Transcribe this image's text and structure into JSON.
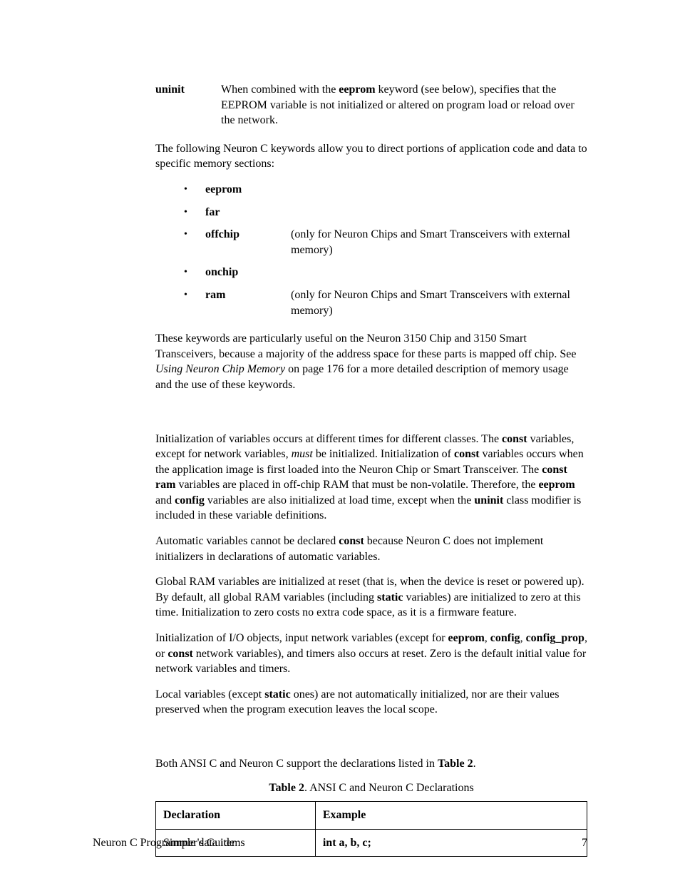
{
  "uninit": {
    "label": "uninit",
    "desc_pre": "When combined with the ",
    "desc_kw": "eeprom",
    "desc_post": " keyword (see below), specifies that the EEPROM variable is not initialized or altered on program load or reload over the network."
  },
  "para1": "The following Neuron C keywords allow you to direct portions of application code and data to specific memory sections:",
  "keywords": [
    {
      "kw": "eeprom",
      "note": ""
    },
    {
      "kw": "far",
      "note": ""
    },
    {
      "kw": "offchip",
      "note": "(only for Neuron Chips and Smart Transceivers with external memory)"
    },
    {
      "kw": "onchip",
      "note": ""
    },
    {
      "kw": "ram",
      "note": "(only for Neuron Chips and Smart Transceivers with external memory)"
    }
  ],
  "para2_pre": "These keywords are particularly useful on the Neuron 3150 Chip and 3150 Smart Transceivers, because a majority of the address space for these parts is mapped off chip.  See ",
  "para2_italic": "Using Neuron Chip Memory",
  "para2_post": " on page 176 for a more detailed description of memory usage and the use of these keywords.",
  "init_p1": {
    "t1": "Initialization of variables occurs at different times for different classes.  The ",
    "b1": "const",
    "t2": " variables, except for network variables, ",
    "i1": "must",
    "t3": " be initialized.  Initialization of ",
    "b2": "const",
    "t4": " variables occurs when the application image is first loaded into the Neuron Chip or Smart Transceiver.  The ",
    "b3": "const ram",
    "t5": " variables are placed in off-chip RAM that must be non-volatile.  Therefore, the ",
    "b4": "eeprom",
    "t6": " and ",
    "b5": "config",
    "t7": " variables are also initialized at load time, except when the ",
    "b6": "uninit",
    "t8": " class modifier is included in these variable definitions."
  },
  "init_p2": {
    "t1": "Automatic variables cannot be declared ",
    "b1": "const",
    "t2": " because Neuron C does not implement initializers in declarations of automatic variables."
  },
  "init_p3": {
    "t1": "Global RAM variables are initialized at reset (that is, when the device is reset or powered up).  By default, all global RAM variables (including ",
    "b1": "static",
    "t2": " variables) are initialized to zero at this time.  Initialization to zero costs no extra code space, as it is a firmware feature."
  },
  "init_p4": {
    "t1": "Initialization of I/O objects, input network variables (except for ",
    "b1": "eeprom",
    "t2": ", ",
    "b2": "config",
    "t3": ", ",
    "b3": "config_prop",
    "t4": ", or ",
    "b4": "const",
    "t5": " network variables), and timers also occurs at reset.  Zero is the default initial value for network variables and timers."
  },
  "init_p5": {
    "t1": "Local variables (except ",
    "b1": "static",
    "t2": " ones) are not automatically initialized, nor are their values preserved when the program execution leaves the local scope."
  },
  "decl_para": {
    "t1": "Both ANSI C and Neuron C support the declarations listed in ",
    "b1": "Table 2",
    "t2": "."
  },
  "table_caption": {
    "b1": "Table 2",
    "t1": ". ANSI C and Neuron C Declarations"
  },
  "table": {
    "h1": "Declaration",
    "h2": "Example",
    "r1c1": "Simple data items",
    "r1c2": "int a, b, c;"
  },
  "footer": {
    "left": "Neuron C Programmer's Guide",
    "right": "7"
  }
}
